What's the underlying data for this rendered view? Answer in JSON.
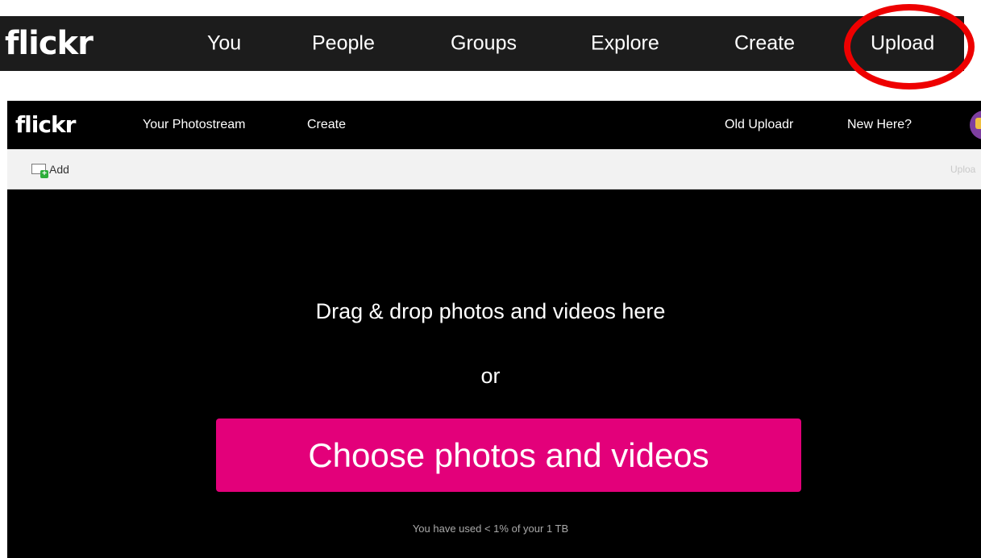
{
  "top_nav": {
    "logo": "flickr",
    "items": [
      "You",
      "People",
      "Groups",
      "Explore",
      "Create",
      "Upload"
    ]
  },
  "inner_nav": {
    "logo": "flickr",
    "left_items": [
      "Your Photostream",
      "Create"
    ],
    "right_items": [
      "Old Uploadr",
      "New Here?"
    ]
  },
  "toolbar": {
    "add_label": "Add",
    "right_label": "Uploa"
  },
  "dropzone": {
    "drag_text": "Drag & drop photos and videos here",
    "or_text": "or",
    "choose_label": "Choose photos and videos",
    "usage_text": "You have used < 1% of your 1 TB"
  },
  "colors": {
    "accent": "#e3007a",
    "highlight": "#ee0000"
  }
}
